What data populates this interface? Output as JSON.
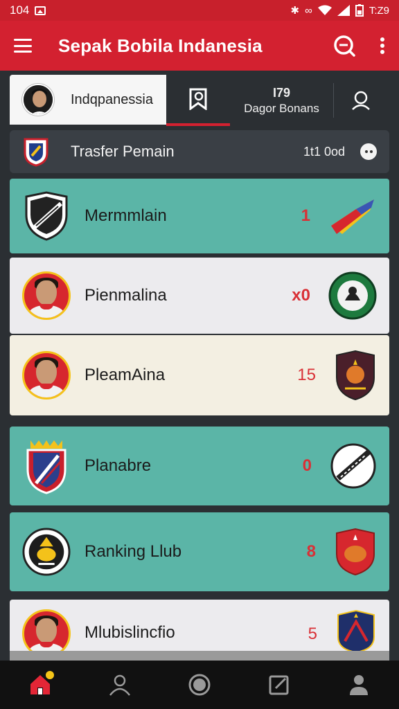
{
  "status_bar": {
    "time": "104",
    "clock": "T:Z9"
  },
  "app_bar": {
    "title": "Sepak Bobila Indanesia",
    "icons": [
      "menu-icon",
      "search-icon",
      "more-vert-icon"
    ]
  },
  "tabs": {
    "country_label": "Indqpanessia",
    "stats_number": "I79",
    "stats_label": "Dagor Bonans"
  },
  "transfer": {
    "label": "Trasfer Pemain",
    "value": "1t1 0od"
  },
  "cards": [
    {
      "name": "Mermmlain",
      "count": "1",
      "color": "#5bb5a7"
    },
    {
      "name": "Pienmalina",
      "count": "x0",
      "color": "#ecebee"
    },
    {
      "name": "PleamAina",
      "count": "15",
      "color": "#f3efe2"
    },
    {
      "name": "Planabre",
      "count": "0",
      "color": "#5bb5a7"
    },
    {
      "name": "Ranking Llub",
      "count": "8",
      "color": "#5bb5a7"
    },
    {
      "name": "Mlubislincfio",
      "count": "5",
      "color": "#ecebee"
    }
  ],
  "bottom_nav": [
    "home-icon",
    "person-icon",
    "circle-icon",
    "edit-icon",
    "account-icon"
  ],
  "colors": {
    "primary": "#d32130",
    "teal": "#5bb5a7",
    "count_red": "#d93036"
  }
}
